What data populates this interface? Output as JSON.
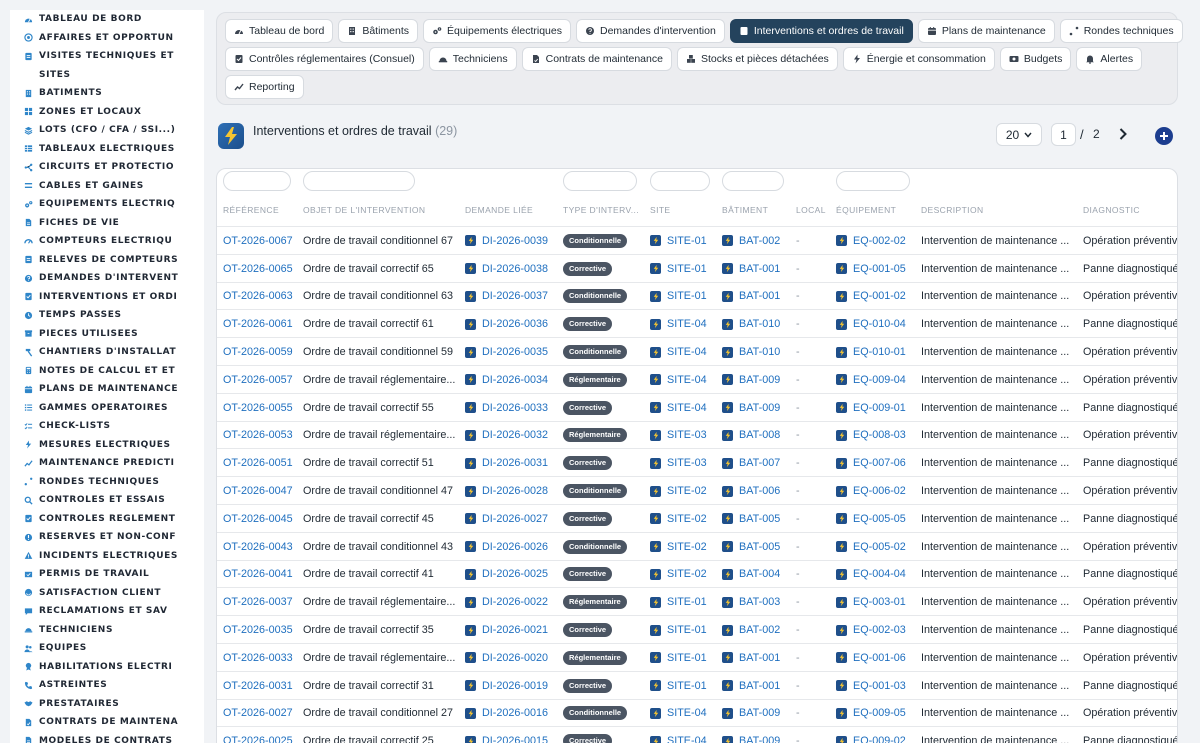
{
  "sidebar": {
    "items": [
      {
        "label": "TABLEAU DE BORD",
        "icon": "dashboard-icon"
      },
      {
        "label": "AFFAIRES ET OPPORTUN",
        "icon": "target-icon"
      },
      {
        "label": "VISITES TECHNIQUES ET",
        "icon": "clipboard-icon"
      },
      {
        "label": "SITES",
        "icon": "map-pin-icon"
      },
      {
        "label": "BÂTIMENTS",
        "icon": "building-icon"
      },
      {
        "label": "ZONES ET LOCAUX",
        "icon": "grid-icon"
      },
      {
        "label": "LOTS (CFO / CFA / SSI...)",
        "icon": "layers-icon"
      },
      {
        "label": "TABLEAUX ÉLECTRIQUES",
        "icon": "table-icon"
      },
      {
        "label": "CIRCUITS ET PROTECTIO",
        "icon": "circuit-icon"
      },
      {
        "label": "CÂBLES ET GAINES",
        "icon": "cable-icon"
      },
      {
        "label": "ÉQUIPEMENTS ÉLECTRIQ",
        "icon": "cogs-icon"
      },
      {
        "label": "FICHES DE VIE",
        "icon": "file-icon"
      },
      {
        "label": "COMPTEURS ÉLECTRIQU",
        "icon": "gauge-icon"
      },
      {
        "label": "RELEVÉS DE COMPTEURS",
        "icon": "clipboard-icon"
      },
      {
        "label": "DEMANDES D'INTERVENT",
        "icon": "question-icon"
      },
      {
        "label": "INTERVENTIONS ET ORDI",
        "icon": "clipboard-check-icon"
      },
      {
        "label": "TEMPS PASSÉS",
        "icon": "clock-icon"
      },
      {
        "label": "PIÈCES UTILISÉES",
        "icon": "box-icon"
      },
      {
        "label": "CHANTIERS D'INSTALLAT",
        "icon": "hammer-icon"
      },
      {
        "label": "NOTES DE CALCUL ET ÉT",
        "icon": "calculator-icon"
      },
      {
        "label": "PLANS DE MAINTENANCE",
        "icon": "calendar-icon"
      },
      {
        "label": "GAMMES OPÉRATOIRES",
        "icon": "list-icon"
      },
      {
        "label": "CHECK-LISTS",
        "icon": "check-list-icon"
      },
      {
        "label": "MESURES ÉLECTRIQUES",
        "icon": "meter-icon"
      },
      {
        "label": "MAINTENANCE PRÉDICTI",
        "icon": "chart-icon"
      },
      {
        "label": "RONDES TECHNIQUES",
        "icon": "route-icon"
      },
      {
        "label": "CONTRÔLES ET ESSAIS",
        "icon": "search-icon"
      },
      {
        "label": "CONTRÔLES RÉGLEMENT",
        "icon": "clipboard-check-icon"
      },
      {
        "label": "RÉSERVES ET NON-CONF",
        "icon": "warning-icon"
      },
      {
        "label": "INCIDENTS ÉLECTRIQUES",
        "icon": "alert-icon"
      },
      {
        "label": "PERMIS DE TRAVAIL",
        "icon": "permit-icon"
      },
      {
        "label": "SATISFACTION CLIENT",
        "icon": "smile-icon"
      },
      {
        "label": "RÉCLAMATIONS ET SAV",
        "icon": "comment-icon"
      },
      {
        "label": "TECHNICIENS",
        "icon": "hard-hat-icon"
      },
      {
        "label": "ÉQUIPES",
        "icon": "users-icon"
      },
      {
        "label": "HABILITATIONS ÉLECTRI",
        "icon": "badge-icon"
      },
      {
        "label": "ASTREINTES",
        "icon": "phone-icon"
      },
      {
        "label": "PRESTATAIRES",
        "icon": "handshake-icon"
      },
      {
        "label": "CONTRATS DE MAINTENA",
        "icon": "contract-icon"
      },
      {
        "label": "MODÈLES DE CONTRATS",
        "icon": "file-icon"
      }
    ]
  },
  "tabs": [
    [
      {
        "label": "Tableau de bord",
        "icon": "dashboard-icon",
        "active": false
      },
      {
        "label": "Bâtiments",
        "icon": "building-icon",
        "active": false
      },
      {
        "label": "Équipements électriques",
        "icon": "cogs-icon",
        "active": false
      },
      {
        "label": "Demandes d'intervention",
        "icon": "question-icon",
        "active": false
      },
      {
        "label": "Interventions et ordres de travail",
        "icon": "clipboard-check-icon",
        "active": true
      },
      {
        "label": "Plans de maintenance",
        "icon": "calendar-icon",
        "active": false
      },
      {
        "label": "Rondes techniques",
        "icon": "route-icon",
        "active": false
      }
    ],
    [
      {
        "label": "Contrôles réglementaires (Consuel)",
        "icon": "clipboard-check-icon",
        "active": false
      },
      {
        "label": "Techniciens",
        "icon": "hard-hat-icon",
        "active": false
      },
      {
        "label": "Contrats de maintenance",
        "icon": "contract-icon",
        "active": false
      },
      {
        "label": "Stocks et pièces détachées",
        "icon": "boxes-icon",
        "active": false
      },
      {
        "label": "Énergie et consommation",
        "icon": "bolt-icon",
        "active": false
      },
      {
        "label": "Budgets",
        "icon": "money-icon",
        "active": false
      },
      {
        "label": "Alertes",
        "icon": "bell-icon",
        "active": false
      }
    ],
    [
      {
        "label": "Reporting",
        "icon": "chart-icon",
        "active": false
      }
    ]
  ],
  "page": {
    "title": "Interventions et ordres de travail",
    "count": "(29)",
    "page_size": "20",
    "current_page": "1",
    "separator": "/",
    "total_pages": "2"
  },
  "table": {
    "columns": [
      "RÉFÉRENCE",
      "OBJET DE L'INTERVENTION",
      "DEMANDE LIÉE",
      "TYPE D'INTERV...",
      "SITE",
      "BÂTIMENT",
      "LOCAL",
      "ÉQUIPEMENT",
      "DESCRIPTION",
      "DIAGNOSTIC"
    ],
    "rows": [
      {
        "ref": "OT-2026-0067",
        "objet": "Ordre de travail conditionnel 67",
        "demande": "DI-2026-0039",
        "type": "Conditionnelle",
        "site": "SITE-01",
        "batiment": "BAT-002",
        "local": "-",
        "equipement": "EQ-002-02",
        "description": "Intervention de maintenance ...",
        "diagnostic": "Opération préventive"
      },
      {
        "ref": "OT-2026-0065",
        "objet": "Ordre de travail correctif 65",
        "demande": "DI-2026-0038",
        "type": "Corrective",
        "site": "SITE-01",
        "batiment": "BAT-001",
        "local": "-",
        "equipement": "EQ-001-05",
        "description": "Intervention de maintenance ...",
        "diagnostic": "Panne diagnostiquée"
      },
      {
        "ref": "OT-2026-0063",
        "objet": "Ordre de travail conditionnel 63",
        "demande": "DI-2026-0037",
        "type": "Conditionnelle",
        "site": "SITE-01",
        "batiment": "BAT-001",
        "local": "-",
        "equipement": "EQ-001-02",
        "description": "Intervention de maintenance ...",
        "diagnostic": "Opération préventive"
      },
      {
        "ref": "OT-2026-0061",
        "objet": "Ordre de travail correctif 61",
        "demande": "DI-2026-0036",
        "type": "Corrective",
        "site": "SITE-04",
        "batiment": "BAT-010",
        "local": "-",
        "equipement": "EQ-010-04",
        "description": "Intervention de maintenance ...",
        "diagnostic": "Panne diagnostiquée"
      },
      {
        "ref": "OT-2026-0059",
        "objet": "Ordre de travail conditionnel 59",
        "demande": "DI-2026-0035",
        "type": "Conditionnelle",
        "site": "SITE-04",
        "batiment": "BAT-010",
        "local": "-",
        "equipement": "EQ-010-01",
        "description": "Intervention de maintenance ...",
        "diagnostic": "Opération préventive"
      },
      {
        "ref": "OT-2026-0057",
        "objet": "Ordre de travail réglementaire...",
        "demande": "DI-2026-0034",
        "type": "Réglementaire",
        "site": "SITE-04",
        "batiment": "BAT-009",
        "local": "-",
        "equipement": "EQ-009-04",
        "description": "Intervention de maintenance ...",
        "diagnostic": "Opération préventive"
      },
      {
        "ref": "OT-2026-0055",
        "objet": "Ordre de travail correctif 55",
        "demande": "DI-2026-0033",
        "type": "Corrective",
        "site": "SITE-04",
        "batiment": "BAT-009",
        "local": "-",
        "equipement": "EQ-009-01",
        "description": "Intervention de maintenance ...",
        "diagnostic": "Panne diagnostiquée"
      },
      {
        "ref": "OT-2026-0053",
        "objet": "Ordre de travail réglementaire...",
        "demande": "DI-2026-0032",
        "type": "Réglementaire",
        "site": "SITE-03",
        "batiment": "BAT-008",
        "local": "-",
        "equipement": "EQ-008-03",
        "description": "Intervention de maintenance ...",
        "diagnostic": "Opération préventive"
      },
      {
        "ref": "OT-2026-0051",
        "objet": "Ordre de travail correctif 51",
        "demande": "DI-2026-0031",
        "type": "Corrective",
        "site": "SITE-03",
        "batiment": "BAT-007",
        "local": "-",
        "equipement": "EQ-007-06",
        "description": "Intervention de maintenance ...",
        "diagnostic": "Panne diagnostiquée"
      },
      {
        "ref": "OT-2026-0047",
        "objet": "Ordre de travail conditionnel 47",
        "demande": "DI-2026-0028",
        "type": "Conditionnelle",
        "site": "SITE-02",
        "batiment": "BAT-006",
        "local": "-",
        "equipement": "EQ-006-02",
        "description": "Intervention de maintenance ...",
        "diagnostic": "Opération préventive"
      },
      {
        "ref": "OT-2026-0045",
        "objet": "Ordre de travail correctif 45",
        "demande": "DI-2026-0027",
        "type": "Corrective",
        "site": "SITE-02",
        "batiment": "BAT-005",
        "local": "-",
        "equipement": "EQ-005-05",
        "description": "Intervention de maintenance ...",
        "diagnostic": "Panne diagnostiquée"
      },
      {
        "ref": "OT-2026-0043",
        "objet": "Ordre de travail conditionnel 43",
        "demande": "DI-2026-0026",
        "type": "Conditionnelle",
        "site": "SITE-02",
        "batiment": "BAT-005",
        "local": "-",
        "equipement": "EQ-005-02",
        "description": "Intervention de maintenance ...",
        "diagnostic": "Opération préventive"
      },
      {
        "ref": "OT-2026-0041",
        "objet": "Ordre de travail correctif 41",
        "demande": "DI-2026-0025",
        "type": "Corrective",
        "site": "SITE-02",
        "batiment": "BAT-004",
        "local": "-",
        "equipement": "EQ-004-04",
        "description": "Intervention de maintenance ...",
        "diagnostic": "Panne diagnostiquée"
      },
      {
        "ref": "OT-2026-0037",
        "objet": "Ordre de travail réglementaire...",
        "demande": "DI-2026-0022",
        "type": "Réglementaire",
        "site": "SITE-01",
        "batiment": "BAT-003",
        "local": "-",
        "equipement": "EQ-003-01",
        "description": "Intervention de maintenance ...",
        "diagnostic": "Opération préventive"
      },
      {
        "ref": "OT-2026-0035",
        "objet": "Ordre de travail correctif 35",
        "demande": "DI-2026-0021",
        "type": "Corrective",
        "site": "SITE-01",
        "batiment": "BAT-002",
        "local": "-",
        "equipement": "EQ-002-03",
        "description": "Intervention de maintenance ...",
        "diagnostic": "Panne diagnostiquée"
      },
      {
        "ref": "OT-2026-0033",
        "objet": "Ordre de travail réglementaire...",
        "demande": "DI-2026-0020",
        "type": "Réglementaire",
        "site": "SITE-01",
        "batiment": "BAT-001",
        "local": "-",
        "equipement": "EQ-001-06",
        "description": "Intervention de maintenance ...",
        "diagnostic": "Opération préventive"
      },
      {
        "ref": "OT-2026-0031",
        "objet": "Ordre de travail correctif 31",
        "demande": "DI-2026-0019",
        "type": "Corrective",
        "site": "SITE-01",
        "batiment": "BAT-001",
        "local": "-",
        "equipement": "EQ-001-03",
        "description": "Intervention de maintenance ...",
        "diagnostic": "Panne diagnostiquée"
      },
      {
        "ref": "OT-2026-0027",
        "objet": "Ordre de travail conditionnel 27",
        "demande": "DI-2026-0016",
        "type": "Conditionnelle",
        "site": "SITE-04",
        "batiment": "BAT-009",
        "local": "-",
        "equipement": "EQ-009-05",
        "description": "Intervention de maintenance ...",
        "diagnostic": "Opération préventive"
      },
      {
        "ref": "OT-2026-0025",
        "objet": "Ordre de travail correctif 25",
        "demande": "DI-2026-0015",
        "type": "Corrective",
        "site": "SITE-04",
        "batiment": "BAT-009",
        "local": "-",
        "equipement": "EQ-009-02",
        "description": "Intervention de maintenance ...",
        "diagnostic": "Panne diagnostiquée"
      }
    ]
  },
  "colors": {
    "active_tab": "#24435d",
    "link": "#1f6fbf",
    "badge": "#4b5563",
    "add_button": "#1c3d8f",
    "sidebar_icon": "#2f86c9"
  }
}
